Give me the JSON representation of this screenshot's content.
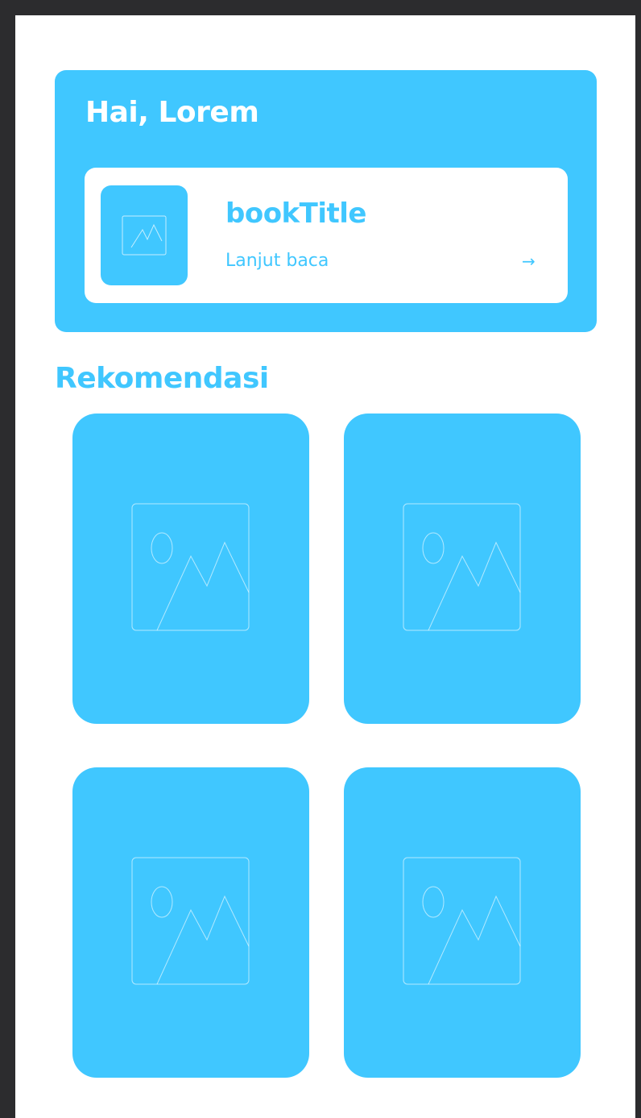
{
  "header": {
    "greeting": "Hai, Lorem"
  },
  "continue_reading": {
    "title": "bookTitle",
    "link_label": "Lanjut baca",
    "arrow": "→",
    "thumbnail_icon": "image-placeholder-icon"
  },
  "recommendations": {
    "title": "Rekomendasi",
    "items": [
      {
        "icon": "image-placeholder-icon"
      },
      {
        "icon": "image-placeholder-icon"
      },
      {
        "icon": "image-placeholder-icon"
      },
      {
        "icon": "image-placeholder-icon"
      }
    ]
  },
  "colors": {
    "accent": "#40c7ff",
    "background": "#ffffff",
    "outer_frame": "#2c2c2e"
  }
}
